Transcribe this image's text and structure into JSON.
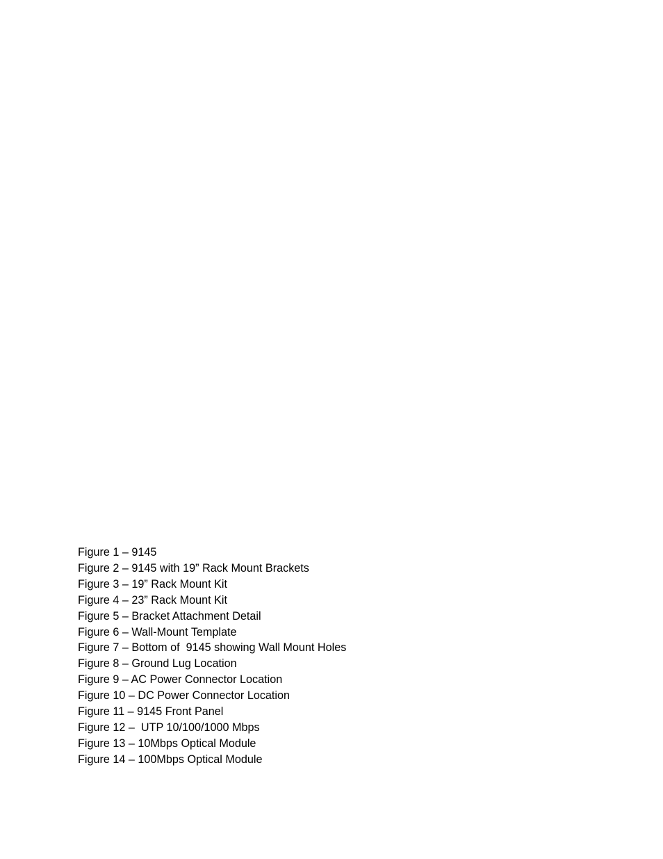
{
  "document": {
    "list_of_figures": [
      {
        "label": "Figure 1 – 9145"
      },
      {
        "label": "Figure 2 – 9145 with 19” Rack Mount Brackets"
      },
      {
        "label": "Figure 3 – 19” Rack Mount Kit"
      },
      {
        "label": "Figure 4 – 23” Rack Mount Kit"
      },
      {
        "label": "Figure 5 – Bracket Attachment Detail"
      },
      {
        "label": "Figure 6 – Wall-Mount Template"
      },
      {
        "label": "Figure 7 – Bottom of  9145 showing Wall Mount Holes"
      },
      {
        "label": "Figure 8 – Ground Lug Location"
      },
      {
        "label": "Figure 9 – AC Power Connector Location"
      },
      {
        "label": "Figure 10 – DC Power Connector Location"
      },
      {
        "label": "Figure 11 – 9145 Front Panel"
      },
      {
        "label": "Figure 12 –  UTP 10/100/1000 Mbps"
      },
      {
        "label": "Figure 13 – 10Mbps Optical Module"
      },
      {
        "label": "Figure 14 – 100Mbps Optical Module"
      }
    ]
  }
}
